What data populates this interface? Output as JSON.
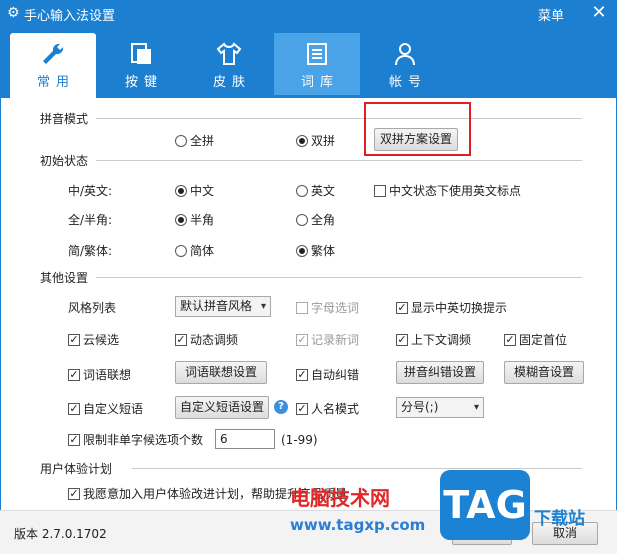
{
  "window": {
    "title": "手心输入法设置",
    "menu_label": "菜单",
    "close_label": "✕"
  },
  "tabs": [
    {
      "label": "常用",
      "icon": "wrench-icon"
    },
    {
      "label": "按键",
      "icon": "keys-icon"
    },
    {
      "label": "皮肤",
      "icon": "shirt-icon"
    },
    {
      "label": "词库",
      "icon": "doc-icon"
    },
    {
      "label": "帐号",
      "icon": "user-icon"
    }
  ],
  "pinyin": {
    "section": "拼音模式",
    "full": "全拼",
    "double": "双拼",
    "scheme_button": "双拼方案设置"
  },
  "initial": {
    "section": "初始状态",
    "cn_en_label": "中/英文:",
    "cn": "中文",
    "en": "英文",
    "cn_en_punct": "中文状态下使用英文标点",
    "half_full_label": "全/半角:",
    "half": "半角",
    "full": "全角",
    "simp_trad_label": "简/繁体:",
    "simp": "简体",
    "trad": "繁体"
  },
  "other": {
    "section": "其他设置",
    "style_label": "风格列表",
    "style_value": "默认拼音风格",
    "letter_select": "字母选词",
    "show_switch_tip": "显示中英切换提示",
    "cloud": "云候选",
    "dynamic_freq": "动态调频",
    "record_new": "记录新词",
    "context_freq": "上下文调频",
    "fixed_first": "固定首位",
    "word_assoc": "词语联想",
    "word_assoc_btn": "词语联想设置",
    "auto_correct": "自动纠错",
    "correct_btn": "拼音纠错设置",
    "fuzzy_btn": "模糊音设置",
    "custom_phrase": "自定义短语",
    "custom_phrase_btn": "自定义短语设置",
    "help": "?",
    "name_mode": "人名模式",
    "name_select": "分号(;)",
    "limit_label": "限制非单字候选项个数",
    "limit_value": "6",
    "limit_range": "(1-99)"
  },
  "ux": {
    "section": "用户体验计划",
    "join": "我愿意加入用户体验改进计划，帮助提升产品质量"
  },
  "footer": {
    "version": "版本 2.7.0.1702",
    "ok": "确定",
    "cancel": "取消"
  },
  "watermark": {
    "site_cn": "电脑技术网",
    "site_url": "www.tagxp.com",
    "tag": "TAG",
    "xz": "下载站"
  },
  "colors": {
    "accent": "#1d7fd0",
    "highlight": "#e02020"
  }
}
